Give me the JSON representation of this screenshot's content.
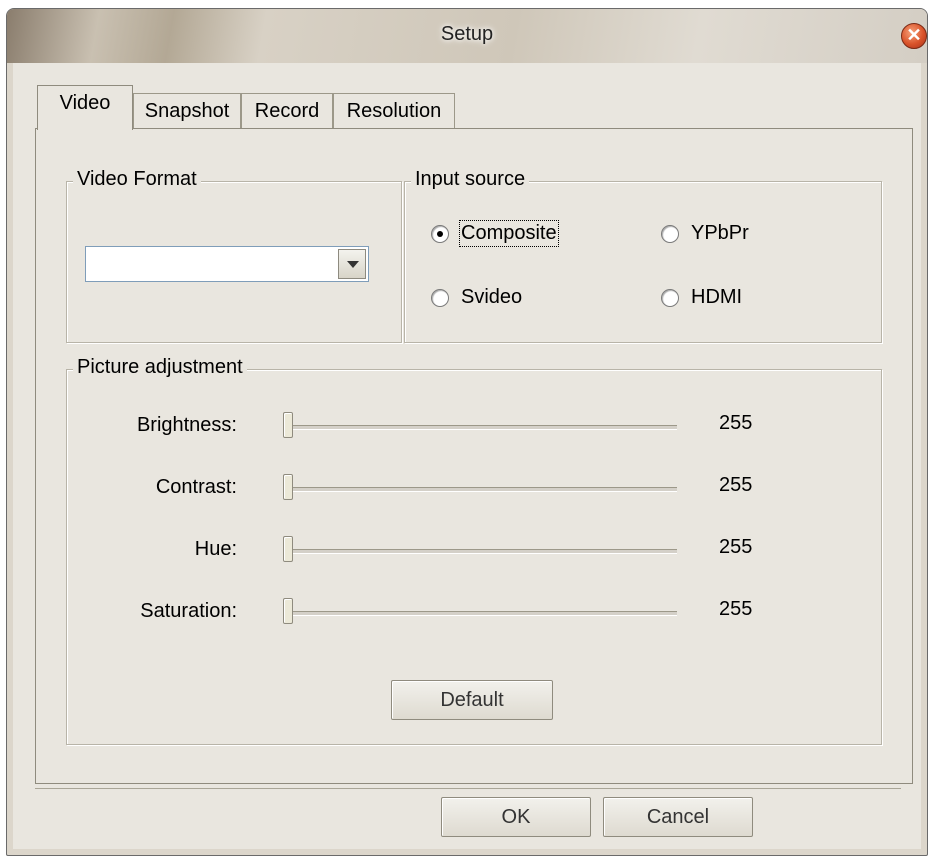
{
  "window": {
    "title": "Setup",
    "close_glyph": "✕"
  },
  "tabs": [
    {
      "label": "Video",
      "active": true
    },
    {
      "label": "Snapshot",
      "active": false
    },
    {
      "label": "Record",
      "active": false
    },
    {
      "label": "Resolution",
      "active": false
    }
  ],
  "video_format": {
    "label": "Video Format",
    "selected_value": ""
  },
  "input_source": {
    "label": "Input source",
    "options": [
      {
        "label": "Composite",
        "checked": true
      },
      {
        "label": "YPbPr",
        "checked": false
      },
      {
        "label": "Svideo",
        "checked": false
      },
      {
        "label": "HDMI",
        "checked": false
      }
    ]
  },
  "picture_adjustment": {
    "label": "Picture adjustment",
    "sliders": [
      {
        "label": "Brightness:",
        "value": "255"
      },
      {
        "label": "Contrast:",
        "value": "255"
      },
      {
        "label": "Hue:",
        "value": "255"
      },
      {
        "label": "Saturation:",
        "value": "255"
      }
    ],
    "default_label": "Default"
  },
  "footer": {
    "ok_label": "OK",
    "cancel_label": "Cancel"
  }
}
